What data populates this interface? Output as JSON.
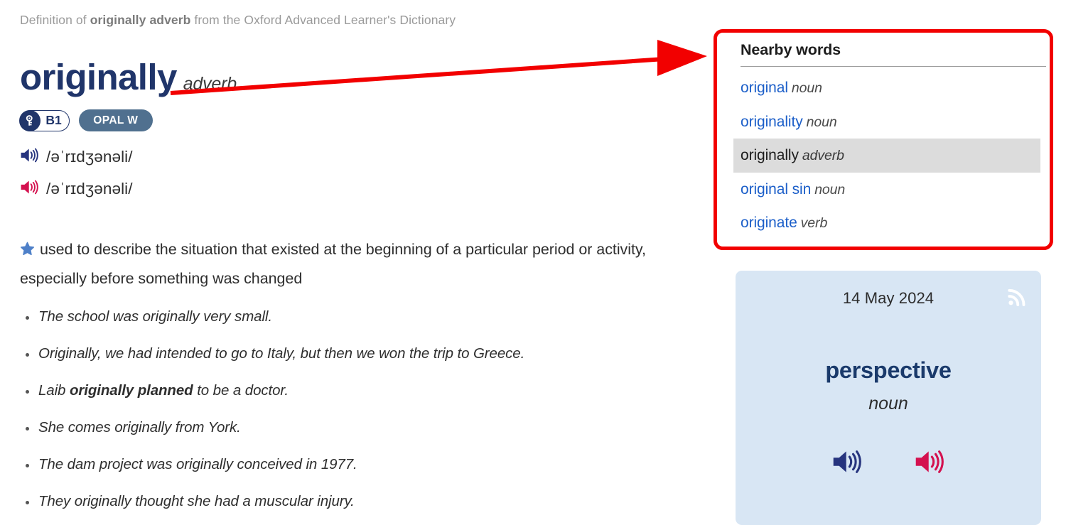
{
  "breadcrumb": {
    "prefix": "Definition of ",
    "entry": "originally adverb",
    "suffix": " from the Oxford Advanced Learner's Dictionary"
  },
  "entry": {
    "headword": "originally",
    "part_of_speech": "adverb",
    "cefr_level": "B1",
    "cefr_icon": "key-icon",
    "opal_label": "OPAL W",
    "pronunciations": [
      {
        "accent": "british",
        "icon": "speaker-icon-blue",
        "ipa": "/əˈrɪdʒənəli/",
        "color": "#26347e"
      },
      {
        "accent": "american",
        "icon": "speaker-icon-red",
        "ipa": "/əˈrɪdʒənəli/",
        "color": "#d4114f"
      }
    ],
    "sense": {
      "star_icon": "star-icon",
      "definition": "used to describe the situation that existed at the beginning of a particular period or activity, especially before something was changed",
      "examples": [
        {
          "before": "The school was originally very small.",
          "bold": "",
          "after": ""
        },
        {
          "before": "Originally, we had intended to go to Italy, but then we won the trip to Greece.",
          "bold": "",
          "after": ""
        },
        {
          "before": "Laib ",
          "bold": "originally planned",
          "after": " to be a doctor."
        },
        {
          "before": "She comes originally from York.",
          "bold": "",
          "after": ""
        },
        {
          "before": "The dam project was originally conceived in 1977.",
          "bold": "",
          "after": ""
        },
        {
          "before": "They originally thought she had a muscular injury.",
          "bold": "",
          "after": ""
        }
      ]
    }
  },
  "nearby_words": {
    "title": "Nearby words",
    "items": [
      {
        "word": "original",
        "pos": "noun",
        "current": false
      },
      {
        "word": "originality",
        "pos": "noun",
        "current": false
      },
      {
        "word": "originally",
        "pos": "adverb",
        "current": true
      },
      {
        "word": "original sin",
        "pos": "noun",
        "current": false
      },
      {
        "word": "originate",
        "pos": "verb",
        "current": false
      }
    ]
  },
  "word_of_the_day": {
    "date": "14 May 2024",
    "word": "perspective",
    "part_of_speech": "noun",
    "rss_icon": "rss-icon",
    "audio": [
      {
        "icon": "speaker-icon-blue",
        "color": "#26347e"
      },
      {
        "icon": "speaker-icon-red",
        "color": "#d4114f"
      }
    ]
  },
  "annotation": {
    "type": "arrow",
    "color": "#f20000",
    "highlight_target": "nearby-words-panel"
  },
  "colors": {
    "headword_navy": "#20356a",
    "link_blue": "#1c5fc9",
    "annotation_red": "#f20000",
    "opal_slate": "#50708f",
    "card_blue": "#d8e6f4",
    "highlight_gray": "#dcdcdc"
  }
}
